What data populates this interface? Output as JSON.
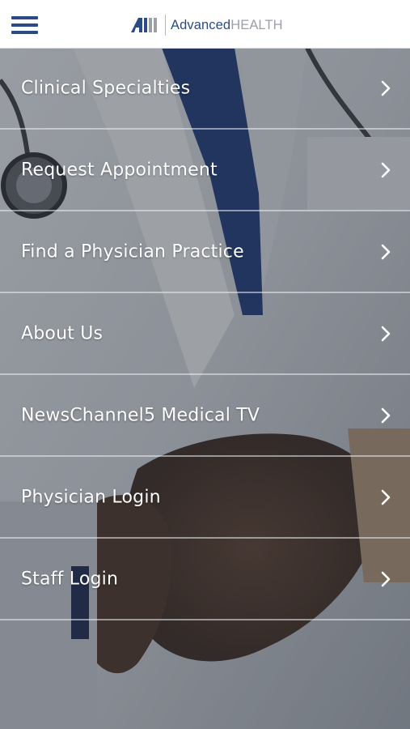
{
  "header": {
    "menu_icon": "hamburger-menu-icon",
    "logo": {
      "brand_primary": "Advanced",
      "brand_secondary": "HEALTH",
      "primary_color": "#2a4c86",
      "secondary_color": "#9aa0a8"
    }
  },
  "menu": {
    "chevron_icon": "chevron-right-icon",
    "items": [
      {
        "label": "Clinical Specialties"
      },
      {
        "label": "Request Appointment"
      },
      {
        "label": "Find a Physician Practice"
      },
      {
        "label": "About Us"
      },
      {
        "label": "NewsChannel5 Medical TV"
      },
      {
        "label": "Physician Login"
      },
      {
        "label": "Staff Login"
      }
    ]
  },
  "colors": {
    "header_bg": "#ffffff",
    "menu_text": "#ffffff",
    "divider": "#e6e9ee"
  }
}
